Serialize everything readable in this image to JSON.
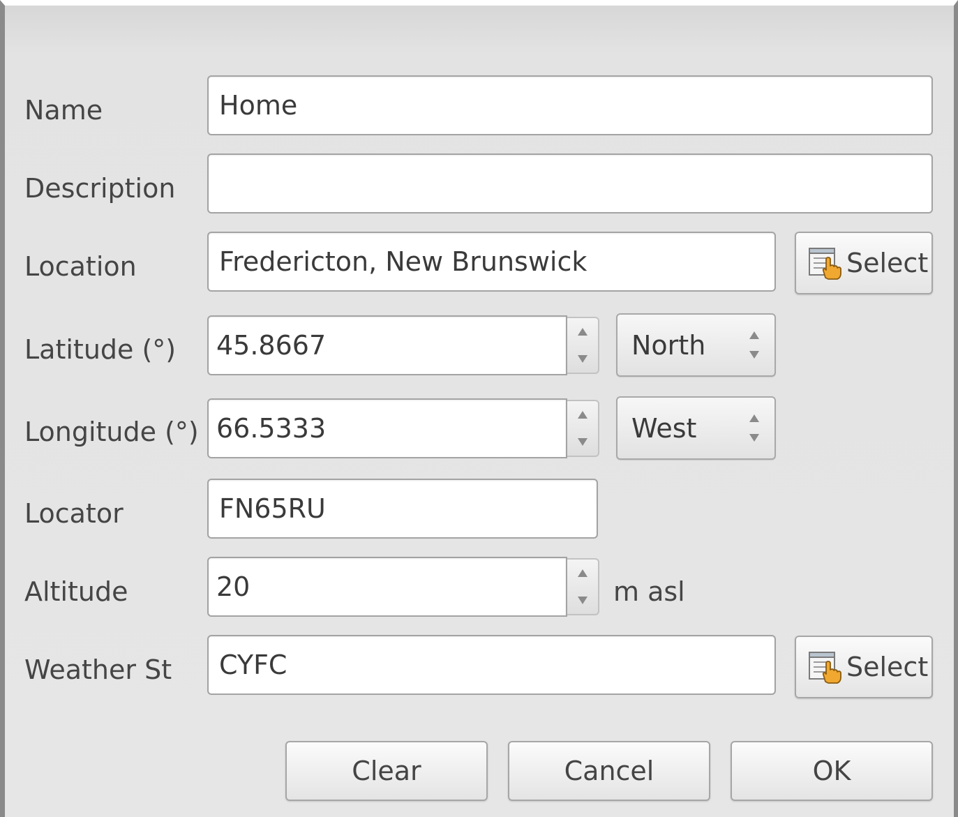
{
  "form": {
    "name_label": "Name",
    "name_value": "Home",
    "description_label": "Description",
    "description_value": "",
    "location_label": "Location",
    "location_value": "Fredericton, New Brunswick",
    "location_select_label": "Select",
    "latitude_label": "Latitude (°)",
    "latitude_value": "45.8667",
    "latitude_hemisphere": "North",
    "longitude_label": "Longitude (°)",
    "longitude_value": "66.5333",
    "longitude_hemisphere": "West",
    "locator_label": "Locator",
    "locator_value": "FN65RU",
    "altitude_label": "Altitude",
    "altitude_value": "20",
    "altitude_unit": "m asl",
    "weather_label": "Weather St",
    "weather_value": "CYFC",
    "weather_select_label": "Select"
  },
  "buttons": {
    "clear": "Clear",
    "cancel": "Cancel",
    "ok": "OK"
  },
  "icons": {
    "select": "table-hand-pointer-icon"
  },
  "colors": {
    "dialog_bg": "#e6e6e6",
    "field_bg": "#ffffff",
    "hand_icon": "#f0a830"
  }
}
